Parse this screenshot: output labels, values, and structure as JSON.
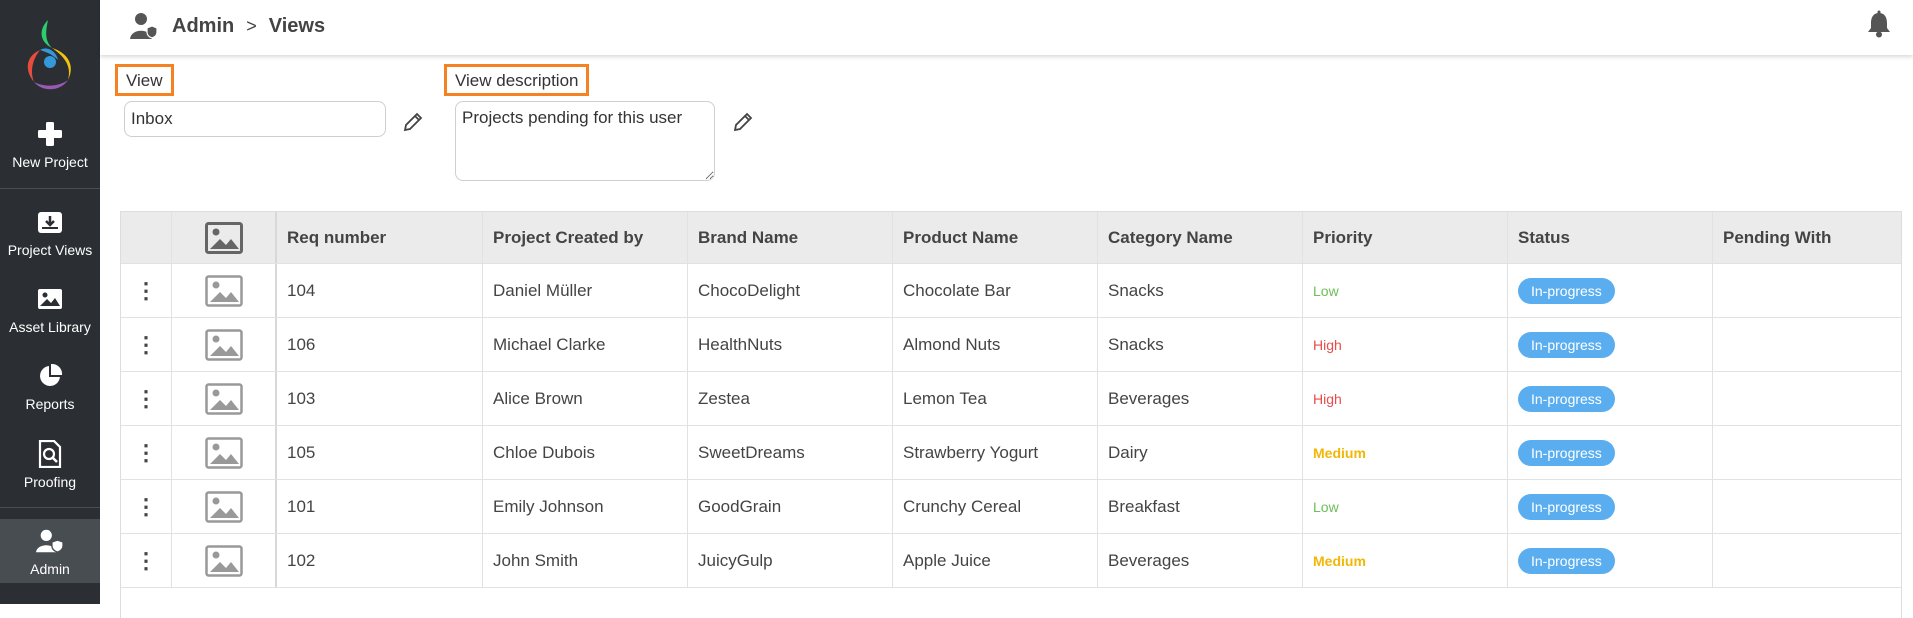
{
  "sidebar": {
    "items": [
      {
        "label": "New Project",
        "icon": "plus-icon"
      },
      {
        "label": "Project Views",
        "icon": "inbox-download-icon"
      },
      {
        "label": "Asset Library",
        "icon": "image-icon"
      },
      {
        "label": "Reports",
        "icon": "pie-chart-icon"
      },
      {
        "label": "Proofing",
        "icon": "document-search-icon"
      },
      {
        "label": "Admin",
        "icon": "admin-user-icon"
      }
    ]
  },
  "header": {
    "crumb_root": "Admin",
    "crumb_sep": ">",
    "crumb_current": "Views"
  },
  "form": {
    "view_label": "View",
    "view_value": "Inbox",
    "desc_label": "View description",
    "desc_value": "Projects pending for this user"
  },
  "table": {
    "headers": [
      "Req number",
      "Project Created by",
      "Brand Name",
      "Product Name",
      "Category Name",
      "Priority",
      "Status",
      "Pending With"
    ],
    "rows": [
      {
        "req": "104",
        "creator": "Daniel Müller",
        "brand": "ChocoDelight",
        "product": "Chocolate Bar",
        "category": "Snacks",
        "priority": "Low",
        "status": "In-progress",
        "pending": ""
      },
      {
        "req": "106",
        "creator": "Michael Clarke",
        "brand": "HealthNuts",
        "product": "Almond Nuts",
        "category": "Snacks",
        "priority": "High",
        "status": "In-progress",
        "pending": ""
      },
      {
        "req": "103",
        "creator": "Alice Brown",
        "brand": "Zestea",
        "product": "Lemon Tea",
        "category": "Beverages",
        "priority": "High",
        "status": "In-progress",
        "pending": ""
      },
      {
        "req": "105",
        "creator": "Chloe Dubois",
        "brand": "SweetDreams",
        "product": "Strawberry Yogurt",
        "category": "Dairy",
        "priority": "Medium",
        "status": "In-progress",
        "pending": ""
      },
      {
        "req": "101",
        "creator": "Emily Johnson",
        "brand": "GoodGrain",
        "product": "Crunchy Cereal",
        "category": "Breakfast",
        "priority": "Low",
        "status": "In-progress",
        "pending": ""
      },
      {
        "req": "102",
        "creator": "John Smith",
        "brand": "JuicyGulp",
        "product": "Apple Juice",
        "category": "Beverages",
        "priority": "Medium",
        "status": "In-progress",
        "pending": ""
      }
    ]
  },
  "colors": {
    "sidebar_bg": "#2b2f33",
    "accent_outline": "#f58220",
    "status_badge": "#5aaef0",
    "priority_low": "#6bbf59",
    "priority_high": "#e84c4c",
    "priority_medium": "#f2b705"
  }
}
